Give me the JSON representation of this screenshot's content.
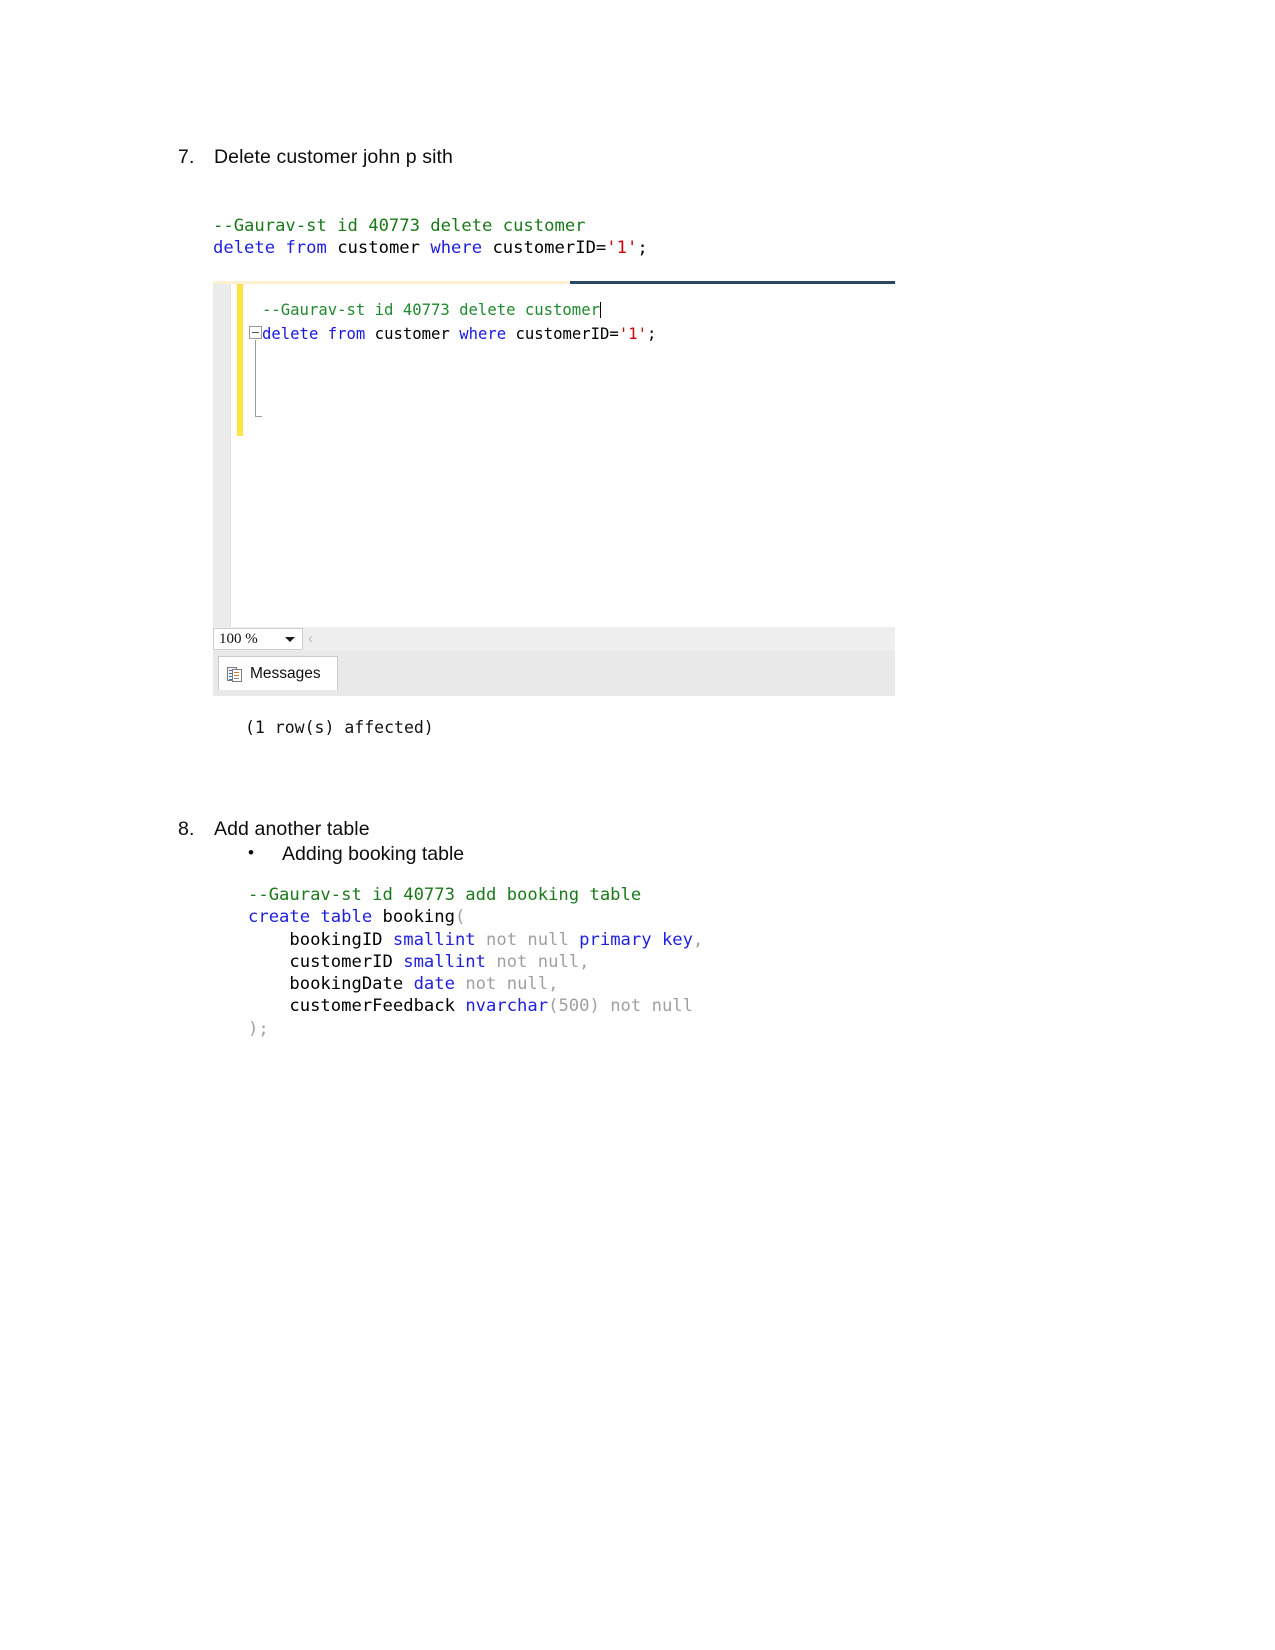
{
  "document": {
    "items": [
      {
        "number": "7.",
        "text": "Delete customer john p sith"
      },
      {
        "number": "8.",
        "text": "Add another table"
      }
    ],
    "bullets": [
      {
        "marker": "•",
        "text": "Adding booking table"
      }
    ]
  },
  "sql_delete": {
    "comment": "--Gaurav-st id 40773 delete customer",
    "kw_delete": "delete",
    "kw_from": "from",
    "table": " customer ",
    "kw_where": "where",
    "col": " customerID=",
    "str_value": "'1'",
    "semicolon": ";"
  },
  "sql_create": {
    "comment": "--Gaurav-st id 40773 add booking table",
    "kw_create_table": "create table",
    "table_name": " booking",
    "open_paren": "(",
    "columns": [
      {
        "name": "    bookingID ",
        "type": "smallint",
        "constraint": " not null ",
        "extra": "primary key",
        "trail": ","
      },
      {
        "name": "    customerID ",
        "type": "smallint",
        "constraint": " not null",
        "extra": "",
        "trail": ","
      },
      {
        "name": "    bookingDate ",
        "type": "date",
        "constraint": " not null",
        "extra": "",
        "trail": ","
      },
      {
        "name": "    customerFeedback ",
        "type": "nvarchar",
        "constraint": "(500)",
        "extra": " not null",
        "trail": ""
      }
    ],
    "close_paren": ");"
  },
  "ssms": {
    "editor_code": {
      "comment": "--Gaurav-st id 40773 delete customer",
      "kw_delete": "delete",
      "kw_from": " from",
      "table": " customer ",
      "kw_where": "where",
      "col": " customerID=",
      "str_value": "'1'",
      "semicolon": ";"
    },
    "zoom_level": "100 %",
    "zoom_chevron": "‹",
    "results_tab_label": "Messages",
    "messages_output": "(1 row(s) affected)"
  },
  "colors": {
    "comment_green": "#1a7a1a",
    "keyword_blue": "#2020e0",
    "string_red": "#d00000",
    "gray_type": "#a0a0a0",
    "change_bar_yellow": "#ffe244",
    "ssms_navy": "#2b4763",
    "ssms_cream": "#fdf0cf"
  }
}
